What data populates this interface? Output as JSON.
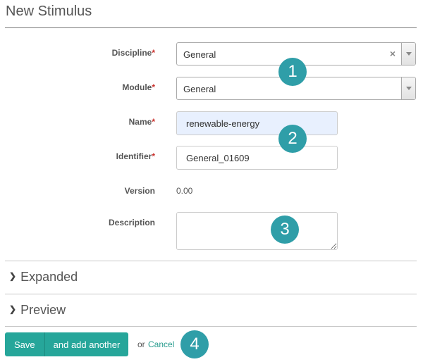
{
  "page": {
    "title": "New Stimulus"
  },
  "form": {
    "required_mark": "*",
    "discipline": {
      "label": "Discipline",
      "value": "General",
      "clear_glyph": "×"
    },
    "module": {
      "label": "Module",
      "value": "General"
    },
    "name": {
      "label": "Name",
      "value": "renewable-energy"
    },
    "identifier": {
      "label": "Identifier",
      "value": "General_01609"
    },
    "version": {
      "label": "Version",
      "value": "0.00"
    },
    "description": {
      "label": "Description",
      "value": ""
    }
  },
  "sections": {
    "expanded": {
      "label": "Expanded",
      "icon": "chevron-right-icon"
    },
    "preview": {
      "label": "Preview",
      "icon": "chevron-right-icon"
    }
  },
  "actions": {
    "save_label": "Save",
    "save_add_label": "and add another",
    "or_text": "or",
    "cancel_label": "Cancel"
  },
  "callouts": [
    "1",
    "2",
    "3",
    "4"
  ],
  "colors": {
    "accent": "#26a69a",
    "callout": "#2f9ea8",
    "link": "#2a9d8f",
    "required": "#c9302c"
  }
}
